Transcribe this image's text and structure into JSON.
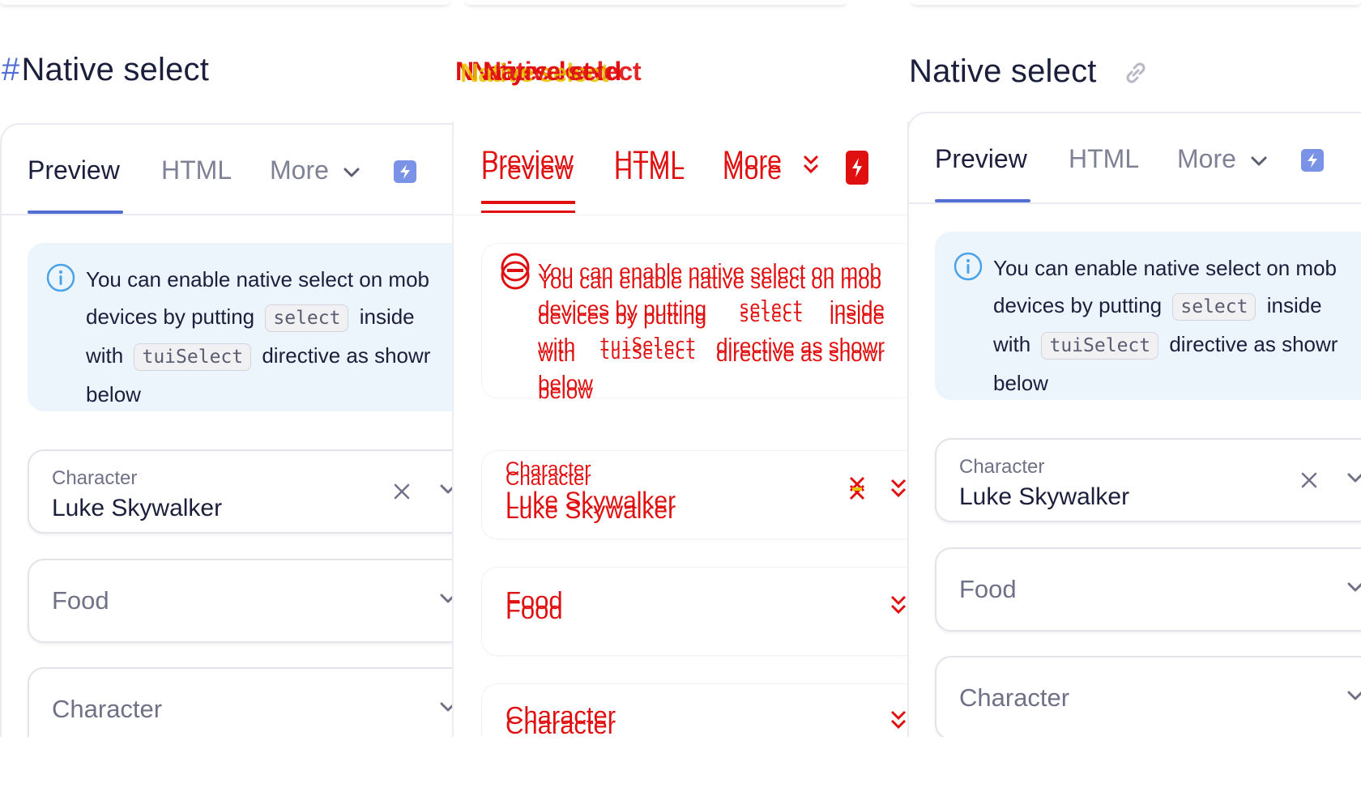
{
  "page": {
    "title": "Native select",
    "hash": "#"
  },
  "tabs": {
    "preview": "Preview",
    "html": "HTML",
    "more": "More"
  },
  "notice": {
    "line1": "You can enable native select on mob",
    "line2_a": "devices by putting",
    "code1": "select",
    "line2_b": "inside",
    "line3_a": "with",
    "code2": "tuiSelect",
    "line3_b": "directive as showr",
    "line4": "below"
  },
  "fields": {
    "character_label": "Character",
    "character_value": "Luke Skywalker",
    "food_placeholder": "Food",
    "character_placeholder": "Character"
  },
  "middle": {
    "title_garbled": "NNatiyesaket cd"
  },
  "colors": {
    "accent": "#526ed3",
    "notice_bg": "#edf5fc",
    "broken_red": "#e01010",
    "broken_yellow": "#e8c400"
  }
}
